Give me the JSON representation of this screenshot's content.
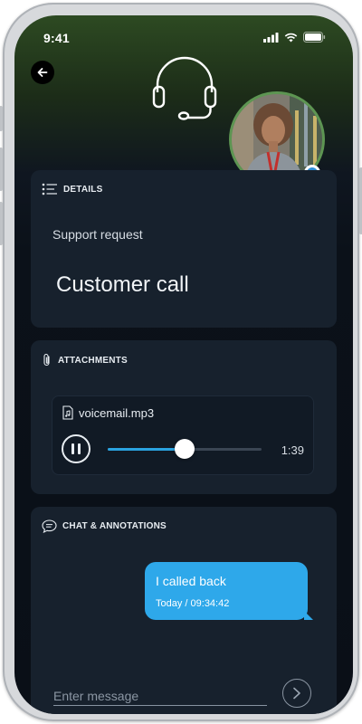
{
  "status_bar": {
    "time": "9:41"
  },
  "icons": {
    "back": "arrow-left-icon",
    "headset": "headset-icon",
    "details": "list-icon",
    "attachments": "paperclip-icon",
    "chat": "chat-bubble-icon",
    "audio_file": "audio-file-icon",
    "pause": "pause-icon",
    "send": "chevron-right-icon"
  },
  "details": {
    "header": "DETAILS",
    "subtitle": "Support request",
    "title": "Customer call"
  },
  "attachments": {
    "header": "ATTACHMENTS",
    "file_name": "voicemail.mp3",
    "duration": "1:39",
    "progress": 0.5
  },
  "chat": {
    "header": "CHAT & ANNOTATIONS",
    "messages": [
      {
        "text": "I called back",
        "time": "Today / 09:34:42"
      }
    ],
    "input_placeholder": "Enter message"
  },
  "colors": {
    "accent": "#2ea8ea",
    "card_bg": "#17212d",
    "presence": "#2f8fd8"
  }
}
